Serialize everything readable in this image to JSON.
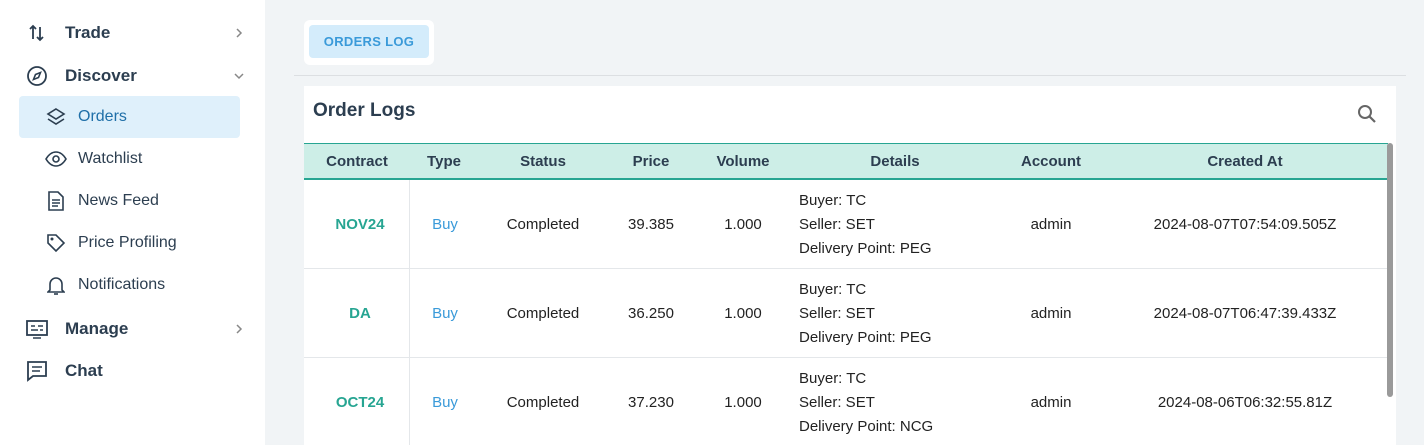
{
  "sidebar": {
    "groups": [
      {
        "label": "Trade",
        "icon": "swap-vertical-icon"
      },
      {
        "label": "Discover",
        "icon": "compass-icon"
      },
      {
        "label": "Manage",
        "icon": "console-icon"
      },
      {
        "label": "Chat",
        "icon": "chat-icon"
      }
    ],
    "items": [
      {
        "label": "Orders",
        "icon": "layers-icon",
        "active": true
      },
      {
        "label": "Watchlist",
        "icon": "eye-icon"
      },
      {
        "label": "News Feed",
        "icon": "document-icon"
      },
      {
        "label": "Price Profiling",
        "icon": "tag-icon"
      },
      {
        "label": "Notifications",
        "icon": "bell-icon"
      }
    ]
  },
  "tabs": {
    "orders_log": "ORDERS LOG"
  },
  "panel": {
    "title": "Order Logs",
    "search_icon": "search-icon"
  },
  "table": {
    "headers": [
      "Contract",
      "Type",
      "Status",
      "Price",
      "Volume",
      "Details",
      "Account",
      "Created At"
    ],
    "rows": [
      {
        "contract": "NOV24",
        "type": "Buy",
        "status": "Completed",
        "price": "39.385",
        "volume": "1.000",
        "buyer": "Buyer: TC",
        "seller": "Seller: SET",
        "delivery": "Delivery Point: PEG",
        "account": "admin",
        "created": "2024-08-07T07:54:09.505Z"
      },
      {
        "contract": "DA",
        "type": "Buy",
        "status": "Completed",
        "price": "36.250",
        "volume": "1.000",
        "buyer": "Buyer: TC",
        "seller": "Seller: SET",
        "delivery": "Delivery Point: PEG",
        "account": "admin",
        "created": "2024-08-07T06:47:39.433Z"
      },
      {
        "contract": "OCT24",
        "type": "Buy",
        "status": "Completed",
        "price": "37.230",
        "volume": "1.000",
        "buyer": "Buyer: TC",
        "seller": "Seller: SET",
        "delivery": "Delivery Point: NCG",
        "account": "admin",
        "created": "2024-08-06T06:32:55.81Z"
      }
    ]
  },
  "colors": {
    "accent_teal": "#27a592",
    "accent_blue": "#3a9ad9",
    "active_bg": "#dff0fb"
  }
}
